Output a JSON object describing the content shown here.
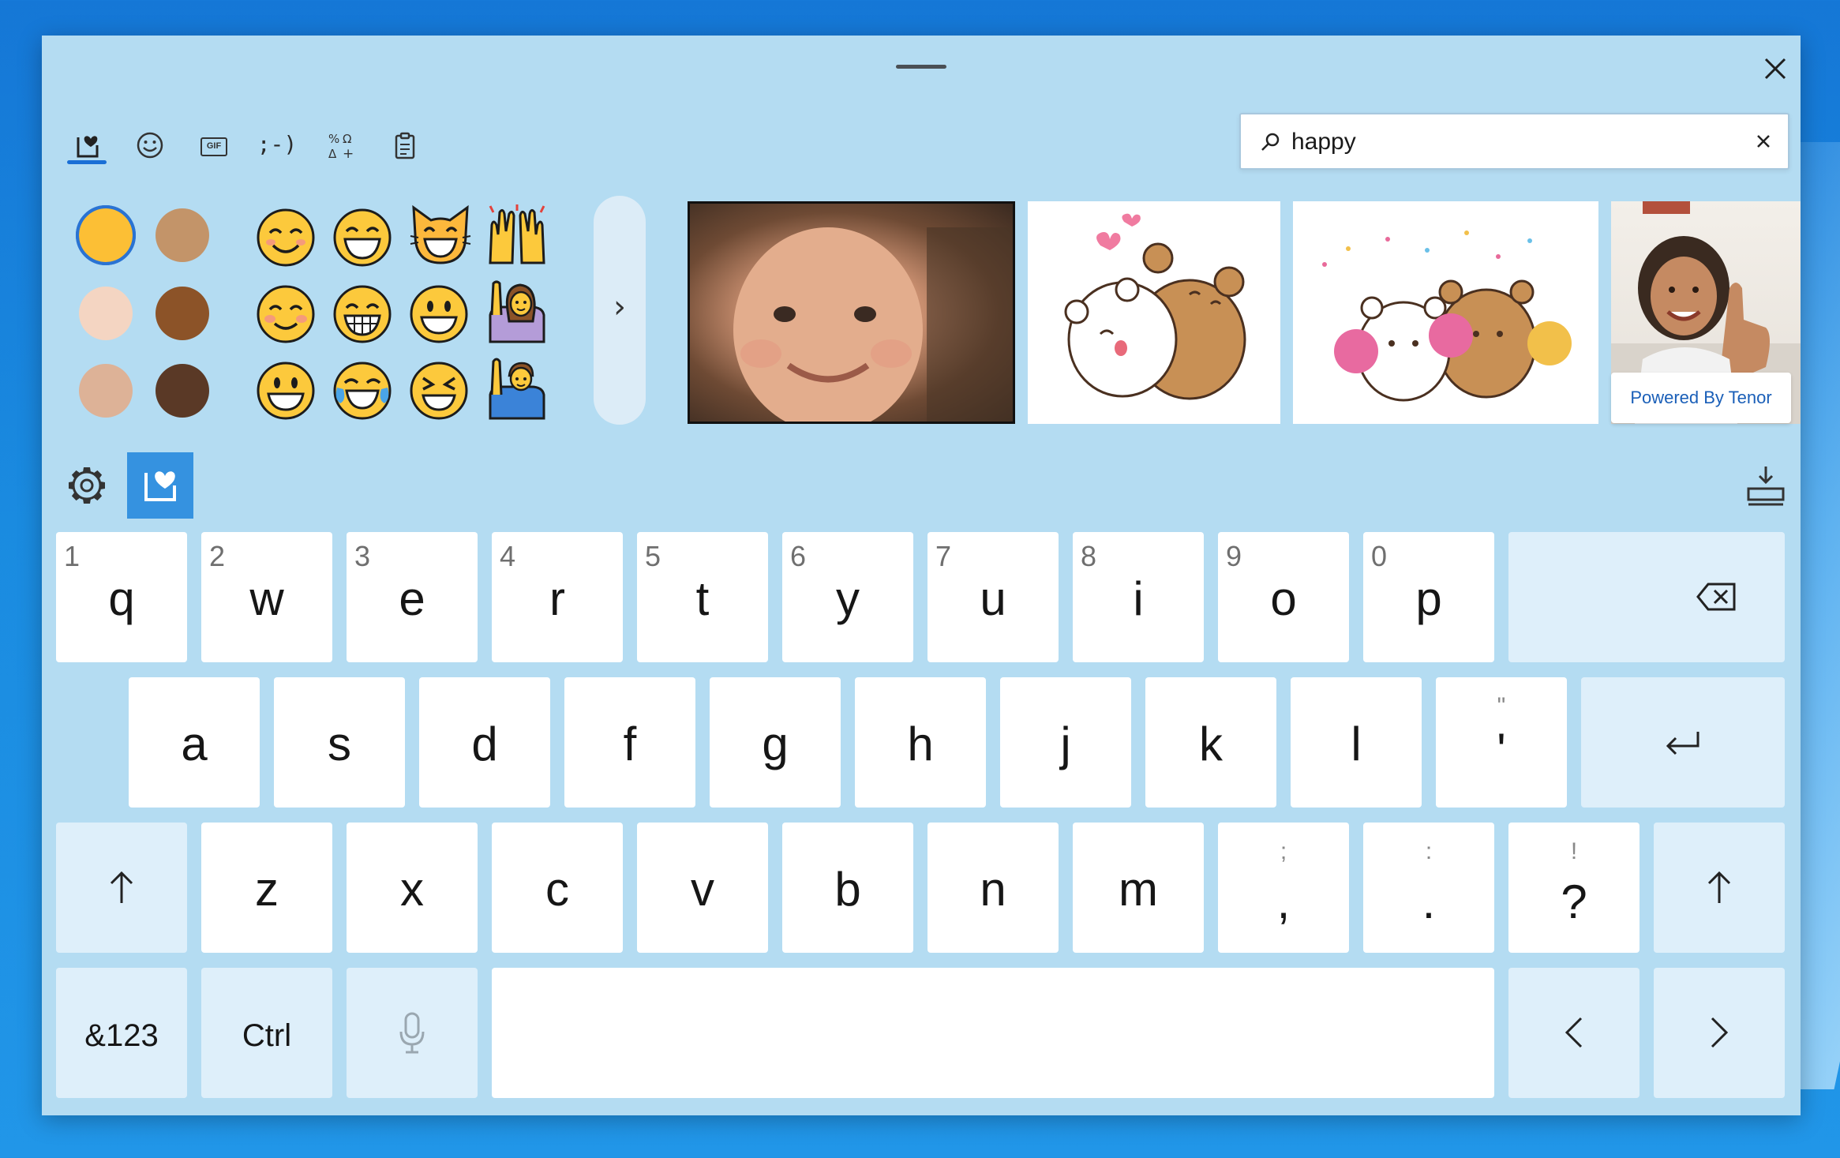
{
  "window": {
    "close_label": "×"
  },
  "tabs": [
    {
      "name": "kaomoji-favorites",
      "label": ""
    },
    {
      "name": "emoji",
      "label": ""
    },
    {
      "name": "gif",
      "label": "GIF"
    },
    {
      "name": "kaomoji",
      "label": ";-)"
    },
    {
      "name": "symbols",
      "label": ""
    },
    {
      "name": "clipboard",
      "label": ""
    }
  ],
  "search": {
    "value": "happy",
    "placeholder": "",
    "clear_label": "×"
  },
  "skin_tones": [
    "#fcbf35",
    "#c39469",
    "#f4d5c2",
    "#8c5328",
    "#ddb297",
    "#5a3926"
  ],
  "emoji": [
    "smiling-face-with-smiling-eyes",
    "grinning-face-with-smiling-eyes",
    "grinning-cat",
    "raising-hands",
    "smiling-face-blush",
    "grimacing-grin",
    "smiling-face",
    "woman-raising-hand",
    "grinning-face",
    "face-with-tears-of-joy",
    "squinting-face",
    "person-raising-hand"
  ],
  "next_label": "›",
  "gifs": [
    "baby-smiling",
    "white-bear-hug-brown-bear",
    "bears-cheerleading",
    "girl-thumbs-up"
  ],
  "tenor_label": "Powered By Tenor",
  "keys": {
    "row1": [
      {
        "num": "1",
        "main": "q"
      },
      {
        "num": "2",
        "main": "w"
      },
      {
        "num": "3",
        "main": "e"
      },
      {
        "num": "4",
        "main": "r"
      },
      {
        "num": "5",
        "main": "t"
      },
      {
        "num": "6",
        "main": "y"
      },
      {
        "num": "7",
        "main": "u"
      },
      {
        "num": "8",
        "main": "i"
      },
      {
        "num": "9",
        "main": "o"
      },
      {
        "num": "0",
        "main": "p"
      }
    ],
    "row2": [
      "a",
      "s",
      "d",
      "f",
      "g",
      "h",
      "j",
      "k",
      "l"
    ],
    "apostrophe": {
      "sub": "\"",
      "main": "'"
    },
    "row3": [
      "z",
      "x",
      "c",
      "v",
      "b",
      "n",
      "m"
    ],
    "comma": {
      "sub": ";",
      "main": ","
    },
    "period": {
      "sub": ":",
      "main": "."
    },
    "question": {
      "sub": "!",
      "main": "?"
    },
    "numbers_label": "&123",
    "ctrl_label": "Ctrl",
    "left_label": "‹",
    "right_label": "›"
  }
}
